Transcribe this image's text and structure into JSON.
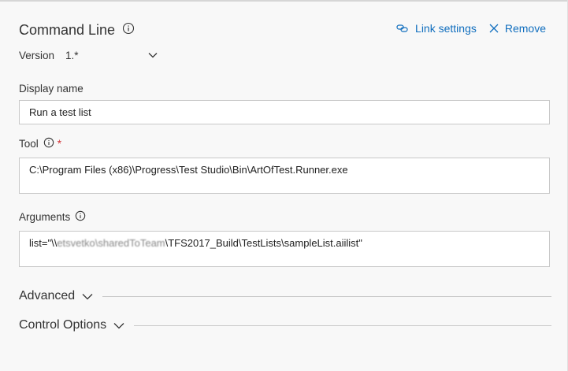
{
  "header": {
    "title": "Command Line",
    "link_settings": "Link settings",
    "remove": "Remove"
  },
  "version": {
    "label": "Version",
    "value": "1.*"
  },
  "display_name": {
    "label": "Display name",
    "value": "Run a test list"
  },
  "tool": {
    "label": "Tool",
    "required_mark": "*",
    "value": "C:\\Program Files (x86)\\Progress\\Test Studio\\Bin\\ArtOfTest.Runner.exe"
  },
  "arguments": {
    "label": "Arguments",
    "value_prefix": "list=\"\\\\",
    "value_obscured": "etsvetko\\sharedToTeam",
    "value_suffix": "\\TFS2017_Build\\TestLists\\sampleList.aiilist\""
  },
  "sections": {
    "advanced": "Advanced",
    "control_options": "Control Options"
  },
  "colors": {
    "accent": "#106ebe",
    "required": "#d13438",
    "background": "#f8f8f8"
  },
  "icons": {
    "info": "info-icon",
    "link": "link-icon",
    "remove": "close-icon",
    "expand": "chevron-down-icon"
  }
}
